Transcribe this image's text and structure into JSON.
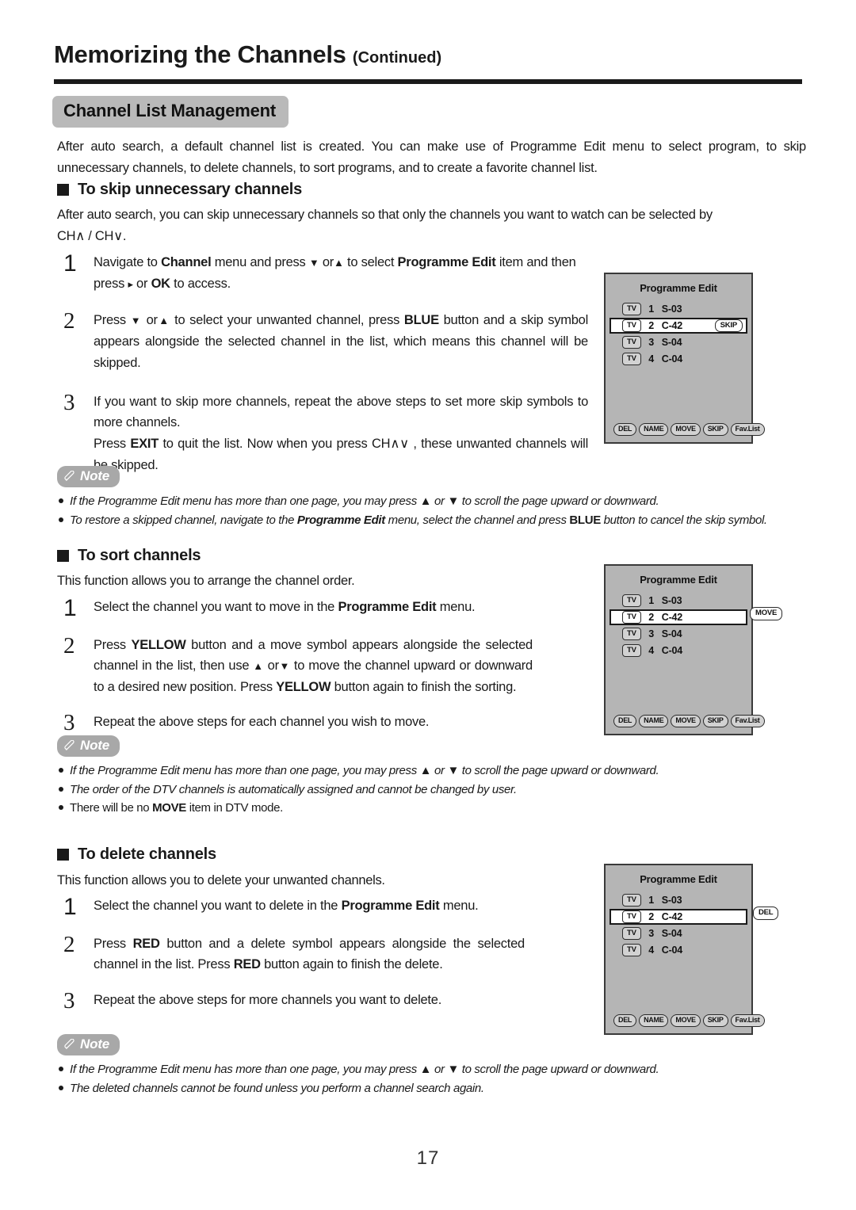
{
  "header": {
    "title": "Memorizing the Channels",
    "continued": "(Continued)"
  },
  "section": {
    "chip_label": "Channel List Management",
    "intro": "After auto search, a default channel list is created. You can make use of Programme Edit menu to select program, to skip unnecessary channels, to delete channels, to sort programs, and to create a favorite channel list."
  },
  "skip_section": {
    "heading": "To skip unnecessary channels",
    "lede_line1": "After auto search, you can skip unnecessary channels so that only the channels you want to watch can be selected by",
    "lede_line2": "CH∧ / CH∨.",
    "steps": [
      {
        "number": "1",
        "text_a": "Navigate to ",
        "bold_a": "Channel",
        "text_b": " menu and press ",
        "arrow_down": "▼",
        "text_or": " or",
        "arrow_up": "▲",
        "text_c": " to select ",
        "bold_b": "Programme Edit",
        "text_d": " item and then press ",
        "arrow_right": "▸",
        "text_e": " or ",
        "bold_c": "OK",
        "text_f": " to access."
      },
      {
        "number": "2",
        "text_a": "Press ",
        "arrow_down": "▼",
        "text_or": " or",
        "arrow_up": "▲",
        "text_b": " to select your unwanted channel, press ",
        "bold_a": "BLUE",
        "text_c": " button and a skip symbol appears alongside the selected channel in the list, which means this channel will be skipped."
      },
      {
        "number": "3",
        "text_a": "If you want to skip more channels, repeat the above steps to set more skip symbols to more channels.",
        "text_b": "Press ",
        "bold_a": "EXIT",
        "text_c": " to quit the list. Now when you press CH",
        "glyph": "∧∨",
        "text_d": " ,  these unwanted channels will be skipped."
      }
    ],
    "note": {
      "badge": "Note",
      "items": [
        {
          "a": "If the Programme Edit menu has more than one page, you may press ",
          "up": "▲",
          "b": " or ",
          "down": "▼",
          "c": "  to scroll the page upward or downward."
        },
        {
          "a": "To restore a skipped channel, navigate to the ",
          "bold1": "Programme Edit",
          "b": " menu, select the channel and press ",
          "bold2": "BLUE",
          "c": " button to cancel the skip symbol."
        }
      ]
    },
    "osd": {
      "title": "Programme Edit",
      "rows": [
        {
          "tag": "TV",
          "number": "1",
          "name": "S-03",
          "flag": "",
          "selected": false
        },
        {
          "tag": "TV",
          "number": "2",
          "name": "C-42",
          "flag": "SKIP",
          "selected": true
        },
        {
          "tag": "TV",
          "number": "3",
          "name": "S-04",
          "flag": "",
          "selected": false
        },
        {
          "tag": "TV",
          "number": "4",
          "name": "C-04",
          "flag": "",
          "selected": false
        }
      ],
      "footer_buttons": [
        "DEL",
        "NAME",
        "MOVE",
        "SKIP",
        "Fav.List"
      ],
      "external_flag": ""
    }
  },
  "sort_section": {
    "heading": "To sort channels",
    "lede": "This function allows you to arrange the channel order.",
    "steps": [
      {
        "number": "1",
        "text_a": "Select the channel you want to move in the ",
        "bold_a": "Programme Edit",
        "text_b": " menu."
      },
      {
        "number": "2",
        "text_a": "Press ",
        "bold_a": "YELLOW",
        "text_b": " button and a move symbol appears alongside the selected channel in the list, then use  ",
        "arrow_up": "▲",
        "text_or": " or",
        "arrow_down": "▼",
        "text_c": " to move the channel upward or downward to a desired new position. Press ",
        "bold_b": "YELLOW",
        "text_d": " button again to finish the sorting."
      },
      {
        "number": "3",
        "text_a": "Repeat the above steps for each channel you wish to move."
      }
    ],
    "note": {
      "badge": "Note",
      "items": [
        {
          "a": "If the Programme Edit menu has more than one page, you may press ",
          "up": "▲",
          "b": " or ",
          "down": "▼",
          "c": "  to scroll the page upward or downward."
        },
        {
          "a": "The order of the DTV channels is automatically assigned and cannot be changed by user."
        },
        {
          "a": "There will be no ",
          "bold1": "MOVE",
          "b": " item in DTV mode.",
          "upright": true
        }
      ]
    },
    "osd": {
      "title": "Programme Edit",
      "rows": [
        {
          "tag": "TV",
          "number": "1",
          "name": "S-03",
          "flag": "",
          "selected": false
        },
        {
          "tag": "TV",
          "number": "2",
          "name": "C-42",
          "flag": "",
          "selected": true
        },
        {
          "tag": "TV",
          "number": "3",
          "name": "S-04",
          "flag": "",
          "selected": false
        },
        {
          "tag": "TV",
          "number": "4",
          "name": "C-04",
          "flag": "",
          "selected": false
        }
      ],
      "footer_buttons": [
        "DEL",
        "NAME",
        "MOVE",
        "SKIP",
        "Fav.List"
      ],
      "external_flag": "MOVE"
    }
  },
  "delete_section": {
    "heading": "To delete channels",
    "lede": "This function allows you to delete your unwanted channels.",
    "steps": [
      {
        "number": "1",
        "text_a": "Select the channel you want to delete in the ",
        "bold_a": "Programme Edit",
        "text_b": " menu."
      },
      {
        "number": "2",
        "text_a": "Press ",
        "bold_a": "RED",
        "text_b": " button and a delete symbol appears alongside the selected channel in the list. Press  ",
        "bold_b": "RED",
        "text_c": " button again to finish the delete."
      },
      {
        "number": "3",
        "text_a": "Repeat the above steps for more channels you want to delete."
      }
    ],
    "note": {
      "badge": "Note",
      "items": [
        {
          "a": "If the Programme Edit menu has more than one page, you may press ",
          "up": "▲",
          "b": " or ",
          "down": "▼",
          "c": "  to scroll the page upward or downward."
        },
        {
          "a": "The deleted channels cannot be found unless you perform a channel search again."
        }
      ]
    },
    "osd": {
      "title": "Programme Edit",
      "rows": [
        {
          "tag": "TV",
          "number": "1",
          "name": "S-03",
          "flag": "",
          "selected": false
        },
        {
          "tag": "TV",
          "number": "2",
          "name": "C-42",
          "flag": "",
          "selected": true
        },
        {
          "tag": "TV",
          "number": "3",
          "name": "S-04",
          "flag": "",
          "selected": false
        },
        {
          "tag": "TV",
          "number": "4",
          "name": "C-04",
          "flag": "",
          "selected": false
        }
      ],
      "footer_buttons": [
        "DEL",
        "NAME",
        "MOVE",
        "SKIP",
        "Fav.List"
      ],
      "external_flag": "DEL"
    }
  },
  "footer": {
    "page_number": "17"
  },
  "colors": {
    "chip_bg": "#b9b9b9",
    "note_badge_bg": "#a8a8a8",
    "osd_bg": "#b5b5b5",
    "rule": "#1a1a1a"
  }
}
